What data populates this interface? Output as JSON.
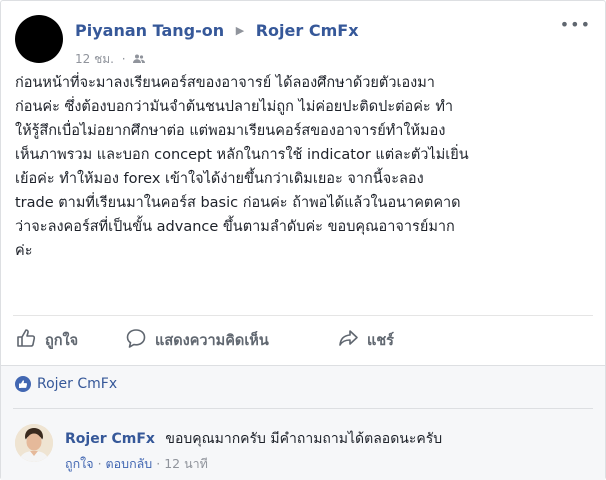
{
  "post": {
    "author": "Piyanan Tang-on",
    "target_page": "Rojer CmFx",
    "time": "12 ชม.",
    "more": "•••",
    "lines": [
      "ก่อนหน้าที่จะมาลงเรียนคอร์สของอาจารย์ ได้ลองศึกษาด้วยตัวเองมา",
      "ก่อนค่ะ ซึ่งต้องบอกว่ามันจำต้นชนปลายไม่ถูก ไม่ค่อยปะติดปะต่อค่ะ ทำ",
      "ให้รู้สึกเบื่อไม่อยากศึกษาต่อ แต่พอมาเรียนคอร์สของอาจารย์ทำให้มอง",
      "เห็นภาพรวม และบอก concept หลักในการใช้ indicator แต่ละตัวไม่เยิ่น",
      "เย้อค่ะ ทำให้มอง forex เข้าใจได้ง่ายขึ้นกว่าเดิมเยอะ จากนี้จะลอง",
      "trade ตามที่เรียนมาในคอร์ส basic ก่อนค่ะ ถ้าพอได้แล้วในอนาคตคาด",
      "ว่าจะลงคอร์สที่เป็นขั้น advance ขึ้นตามลำดับค่ะ ขอบคุณอาจารย์มาก",
      "ค่ะ"
    ]
  },
  "actions": {
    "like": "ถูกใจ",
    "comment": "แสดงความคิดเห็น",
    "share": "แชร์"
  },
  "likes": {
    "liker": "Rojer CmFx"
  },
  "comment": {
    "name": "Rojer CmFx",
    "text": "ขอบคุณมากครับ มีคำถามถามได้ตลอดนะครับ",
    "like": "ถูกใจ",
    "reply": "ตอบกลับ",
    "time": "12 นาที"
  },
  "colors": {
    "link": "#365899",
    "text": "#1d2129",
    "muted": "#90949c",
    "like_badge": "#4267b2"
  }
}
